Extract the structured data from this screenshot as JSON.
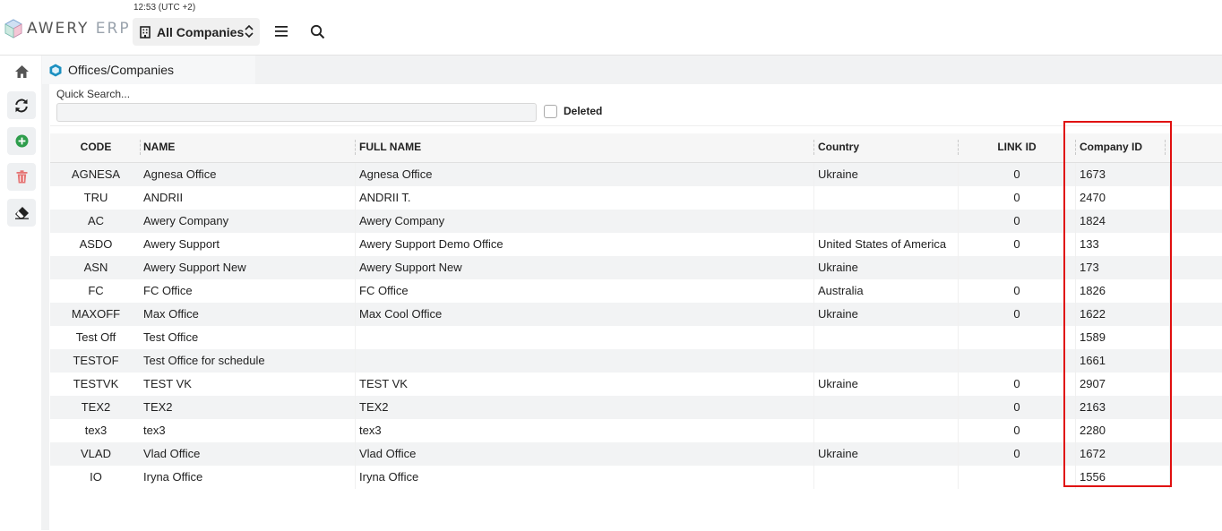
{
  "header": {
    "logo_text": "AWERY",
    "logo_suffix": "ERP",
    "clock": "12:53 (UTC +2)",
    "company_selector": "All Companies"
  },
  "tabs": [
    {
      "label": "Offices/Companies"
    }
  ],
  "search": {
    "label": "Quick Search...",
    "value": "",
    "deleted_label": "Deleted",
    "deleted_checked": false
  },
  "table": {
    "columns": [
      "CODE",
      "NAME",
      "FULL NAME",
      "Country",
      "LINK ID",
      "Company ID"
    ],
    "rows": [
      [
        "AGNESA",
        "Agnesa Office",
        "Agnesa Office",
        "Ukraine",
        "0",
        "1673"
      ],
      [
        "TRU",
        "ANDRII",
        "ANDRII T.",
        "",
        "0",
        "2470"
      ],
      [
        "AC",
        "Awery Company",
        "Awery Company",
        "",
        "0",
        "1824"
      ],
      [
        "ASDO",
        "Awery Support",
        "Awery Support Demo Office",
        "United States of America",
        "0",
        "133"
      ],
      [
        "ASN",
        "Awery Support New",
        "Awery Support New",
        "Ukraine",
        "",
        "173"
      ],
      [
        "FC",
        "FC Office",
        "FC Office",
        "Australia",
        "0",
        "1826"
      ],
      [
        "MAXOFF",
        "Max Office",
        "Max Cool Office",
        "Ukraine",
        "0",
        "1622"
      ],
      [
        "Test Off",
        "Test Office",
        "",
        "",
        "",
        "1589"
      ],
      [
        "TESTOF",
        "Test Office for schedule",
        "",
        "",
        "",
        "1661"
      ],
      [
        "TESTVK",
        "TEST VK",
        "TEST VK",
        "Ukraine",
        "0",
        "2907"
      ],
      [
        "TEX2",
        "TEX2",
        "TEX2",
        "",
        "0",
        "2163"
      ],
      [
        "tex3",
        "tex3",
        "tex3",
        "",
        "0",
        "2280"
      ],
      [
        "VLAD",
        "Vlad Office",
        "Vlad Office",
        "Ukraine",
        "0",
        "1672"
      ],
      [
        "IO",
        "Iryna Office",
        "Iryna Office",
        "",
        "",
        "1556"
      ]
    ]
  },
  "colors": {
    "accent": "#1b8fc0",
    "add_green": "#2e9d4c",
    "delete_red": "#e57373",
    "highlight": "#e01010"
  },
  "icons": {
    "home": "home-icon",
    "refresh": "refresh-icon",
    "add": "add-circle-icon",
    "delete": "trash-icon",
    "clear": "eraser-icon",
    "menu": "hamburger-menu-icon",
    "search": "search-icon",
    "building": "building-icon"
  }
}
